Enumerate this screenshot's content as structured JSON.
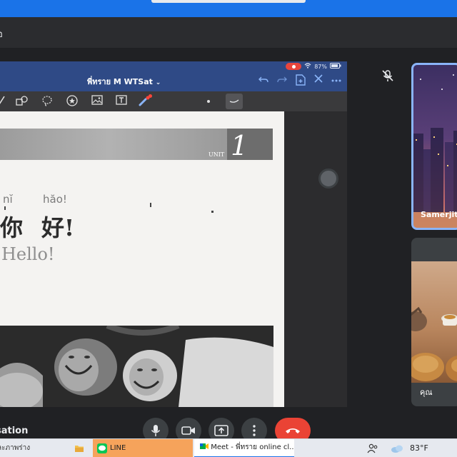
{
  "header": {
    "text": "อ"
  },
  "ipad": {
    "status": {
      "battery": "87%"
    },
    "doc_title": "พี่ทราย M WTSat",
    "title_chevron": "⌄"
  },
  "page": {
    "unit_label": "UNIT",
    "unit_number": "1",
    "pinyin_1": "nĭ",
    "pinyin_2": "hăo!",
    "hanzi_1": "你",
    "hanzi_2": "好!",
    "english": "Hello!"
  },
  "participants": [
    {
      "name": "Samerjit"
    },
    {
      "name": "คุณ"
    }
  ],
  "controls": {
    "meeting_name": "sation"
  },
  "taskbar": {
    "search_text": "ละภาพร่าง",
    "line_label": "LINE",
    "meet_label": "Meet - พี่ทราย online cl...",
    "temperature": "83°F"
  },
  "colors": {
    "meet_bg": "#202124",
    "ipad_titlebar": "#2f4a86",
    "accent_blue": "#8ab4f8",
    "end_call_red": "#ea4335"
  }
}
